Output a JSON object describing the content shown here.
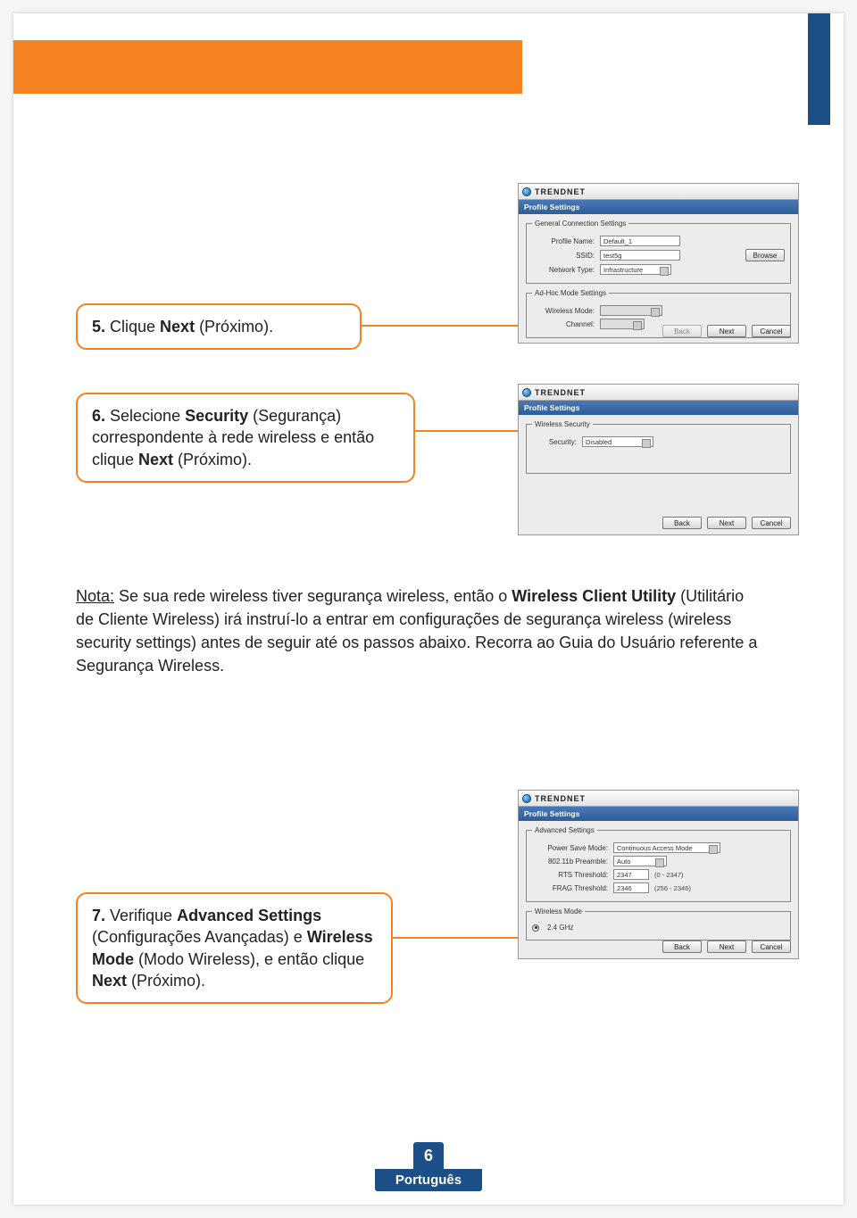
{
  "header": {
    "orange_bar": true,
    "blue_bar": true
  },
  "callouts": {
    "step5_prefix": "5.",
    "step5_text_a": " Clique ",
    "step5_bold_a": "Next",
    "step5_text_b": " (Próximo).",
    "step6_prefix": "6.",
    "step6_text_a": " Selecione ",
    "step6_bold_a": "Security",
    "step6_text_b": " (Segurança) correspondente à rede wireless e então clique ",
    "step6_bold_b": "Next",
    "step6_text_c": " (Próximo).",
    "step7_prefix": "7.",
    "step7_text_a": " Verifique ",
    "step7_bold_a": "Advanced Settings",
    "step7_text_b": " (Configurações Avançadas) e ",
    "step7_bold_b": "Wireless Mode",
    "step7_text_c": " (Modo Wireless), e então clique ",
    "step7_bold_c": "Next",
    "step7_text_d": " (Próximo)."
  },
  "note": {
    "label": "Nota:",
    "text_a": " Se sua rede wireless tiver segurança wireless, então o ",
    "bold_a": "Wireless Client Utility",
    "text_b": " (Utilitário de Cliente Wireless) irá instruí-lo a entrar em configurações de segurança wireless (wireless security settings) antes de seguir até os passos abaixo. Recorra ao Guia do Usuário referente a Segurança Wireless."
  },
  "shots": {
    "brand": "TRENDNET",
    "subtitle": "Profile Settings",
    "buttons": {
      "back": "Back",
      "next": "Next",
      "cancel": "Cancel",
      "browse": "Browse"
    },
    "shot1": {
      "group1_legend": "General Connection Settings",
      "profile_name_label": "Profile Name:",
      "profile_name_value": "Default_1",
      "ssid_label": "SSID:",
      "ssid_value": "test5g",
      "network_type_label": "Network Type:",
      "network_type_value": "Infrastructure",
      "group2_legend": "Ad-Hoc Mode Settings",
      "wireless_mode_label": "Wireless Mode:",
      "channel_label": "Channel:"
    },
    "shot2": {
      "group_legend": "Wireless Security",
      "security_label": "Security:",
      "security_value": "Disabled"
    },
    "shot3": {
      "group1_legend": "Advanced Settings",
      "psm_label": "Power Save Mode:",
      "psm_value": "Continuous Access Mode",
      "preamble_label": "802.11b Preamble:",
      "preamble_value": "Auto",
      "rts_label": "RTS Threshold:",
      "rts_value": "2347",
      "rts_range": "(0 - 2347)",
      "frag_label": "FRAG Threshold:",
      "frag_value": "2346",
      "frag_range": "(256 - 2346)",
      "group2_legend": "Wireless Mode",
      "mode_value": "2.4 GHz"
    }
  },
  "footer": {
    "page_number": "6",
    "language": "Português"
  }
}
